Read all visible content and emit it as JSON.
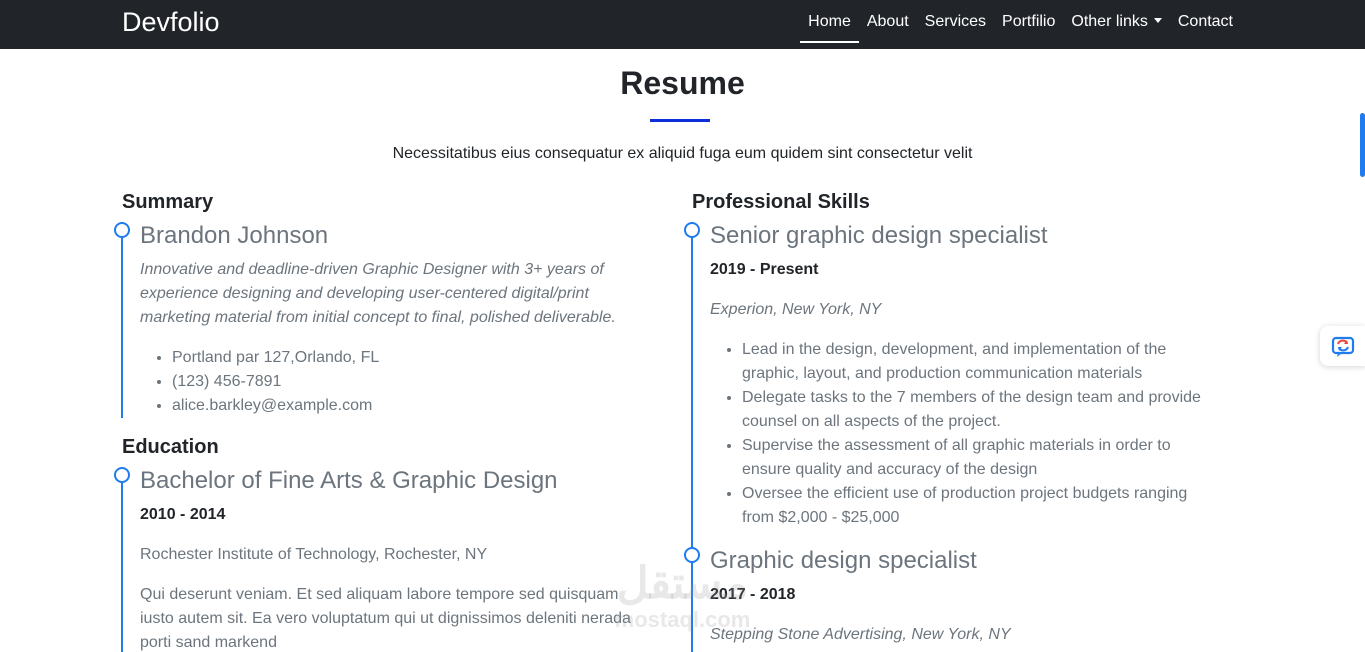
{
  "navbar": {
    "brand": "Devfolio",
    "items": [
      {
        "label": "Home",
        "active": true
      },
      {
        "label": "About"
      },
      {
        "label": "Services"
      },
      {
        "label": "Portfilio"
      },
      {
        "label": "Other links",
        "dropdown": true
      },
      {
        "label": "Contact"
      }
    ]
  },
  "section": {
    "title": "Resume",
    "subtitle": "Necessitatibus eius consequatur ex aliquid fuga eum quidem sint consectetur velit"
  },
  "summary": {
    "heading": "Summary",
    "name": "Brandon Johnson",
    "description": "Innovative and deadline-driven Graphic Designer with 3+ years of experience designing and developing user-centered digital/print marketing material from initial concept to final, polished deliverable.",
    "contacts": [
      "Portland par 127,Orlando, FL",
      "(123) 456-7891",
      "alice.barkley@example.com"
    ]
  },
  "education": {
    "heading": "Education",
    "degree": "Bachelor of Fine Arts & Graphic Design",
    "years": "2010 - 2014",
    "school": "Rochester Institute of Technology, Rochester, NY",
    "description": "Qui deserunt veniam. Et sed aliquam labore tempore sed quisquam iusto autem sit. Ea vero voluptatum qui ut dignissimos deleniti nerada porti sand markend"
  },
  "skills": {
    "heading": "Professional Skills",
    "jobs": [
      {
        "title": "Senior graphic design specialist",
        "years": "2019 - Present",
        "company": "Experion, New York, NY",
        "bullets": [
          "Lead in the design, development, and implementation of the graphic, layout, and production communication materials",
          "Delegate tasks to the 7 members of the design team and provide counsel on all aspects of the project.",
          "Supervise the assessment of all graphic materials in order to ensure quality and accuracy of the design",
          "Oversee the efficient use of production project budgets ranging from $2,000 - $25,000"
        ]
      },
      {
        "title": "Graphic design specialist",
        "years": "2017 - 2018",
        "company": "Stepping Stone Advertising, New York, NY"
      }
    ]
  },
  "watermark": {
    "arabic": "مستقل",
    "latin": "mostaql.com"
  },
  "colors": {
    "navbar": "#212529",
    "accent": "#1e7bf0",
    "title_underline": "#0d2ed8",
    "muted_text": "#6c757d"
  },
  "icons": {
    "chat_widget": "chat-refresh-icon",
    "dropdown": "caret-down-icon"
  }
}
